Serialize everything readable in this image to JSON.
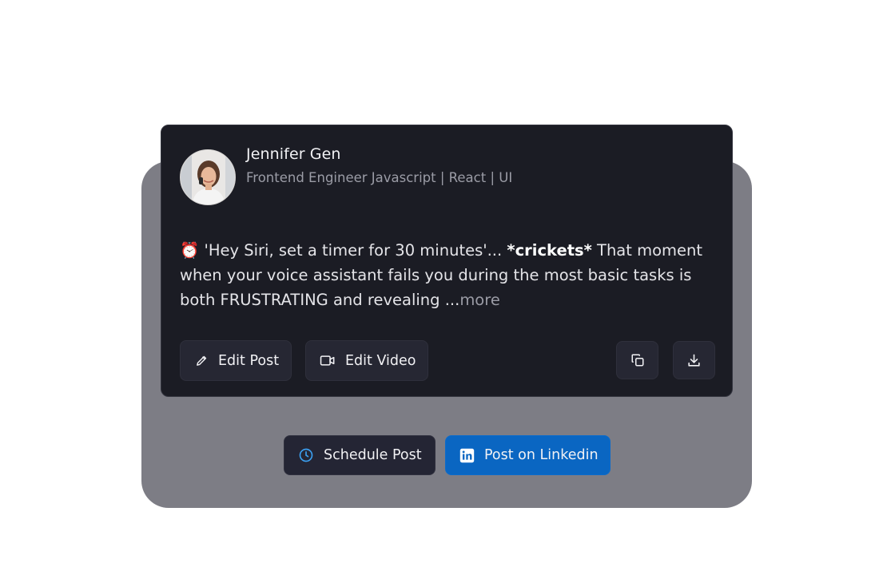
{
  "post": {
    "author": {
      "name": "Jennifer Gen",
      "headline": "Frontend Engineer Javascript | React | UI"
    },
    "body": {
      "emoji": "⏰",
      "text_before": " 'Hey Siri, set a timer for 30 minutes'... ",
      "bold": "*crickets*",
      "text_after": " That moment when your voice assistant fails you during the most basic tasks is both FRUSTRATING and revealing ...",
      "more_label": "more"
    },
    "actions": {
      "edit_post_label": "Edit Post",
      "edit_video_label": "Edit Video"
    },
    "icons": {
      "edit": "pencil-icon",
      "video": "video-camera-icon",
      "copy": "copy-icon",
      "download": "download-icon"
    }
  },
  "footer": {
    "schedule_label": "Schedule Post",
    "linkedin_label": "Post on Linkedin",
    "icons": {
      "schedule": "clock-icon",
      "linkedin": "linkedin-icon"
    }
  },
  "colors": {
    "card_bg": "#1b1c24",
    "backdrop": "#7d7d85",
    "linkedin_blue": "#0a66c2",
    "clock_accent": "#3b9ff0"
  }
}
